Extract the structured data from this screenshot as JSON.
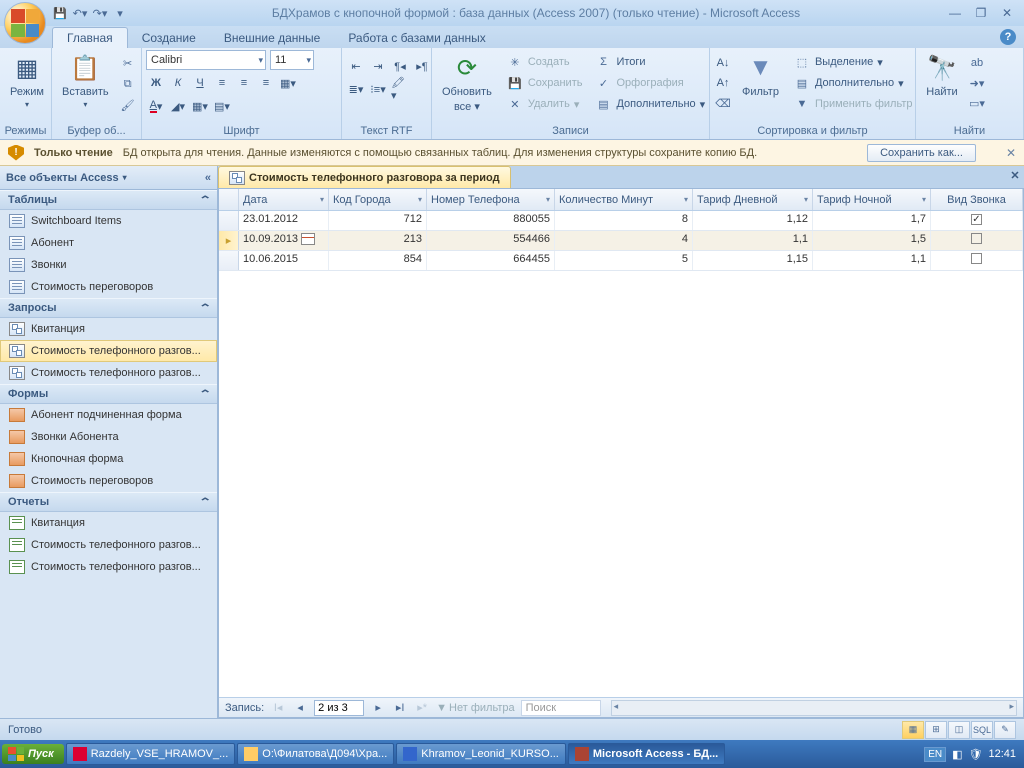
{
  "title": "БДХрамов с кнопочной формой : база данных (Access 2007) (только чтение) - Microsoft Access",
  "tabs": {
    "t1": "Главная",
    "t2": "Создание",
    "t3": "Внешние данные",
    "t4": "Работа с базами данных"
  },
  "ribbon": {
    "g1": {
      "label": "Режимы",
      "btn": "Режим"
    },
    "g2": {
      "label": "Буфер об...",
      "btn": "Вставить"
    },
    "g3": {
      "label": "Шрифт",
      "font": "Calibri",
      "size": "11"
    },
    "g4": {
      "label": "Текст RTF"
    },
    "g5": {
      "label": "Записи",
      "refresh": "Обновить",
      "refresh2": "все",
      "new": "Создать",
      "save": "Сохранить",
      "del": "Удалить",
      "sum": "Итоги",
      "spell": "Орфография",
      "more": "Дополнительно"
    },
    "g6": {
      "label": "Сортировка и фильтр",
      "filter": "Фильтр",
      "sel": "Выделение",
      "adv": "Дополнительно",
      "toggle": "Применить фильтр"
    },
    "g7": {
      "label": "Найти",
      "find": "Найти"
    }
  },
  "msgbar": {
    "title": "Только чтение",
    "text": "БД открыта для чтения. Данные изменяются с помощью связанных таблиц. Для изменения структуры сохраните копию БД.",
    "btn": "Сохранить как..."
  },
  "nav": {
    "header": "Все объекты Access",
    "cat_tables": "Таблицы",
    "tables": [
      "Switchboard Items",
      "Абонент",
      "Звонки",
      "Стоимость переговоров"
    ],
    "cat_queries": "Запросы",
    "queries": [
      "Квитанция",
      "Стоимость телефонного разгов...",
      "Стоимость телефонного разгов..."
    ],
    "cat_forms": "Формы",
    "forms": [
      "Абонент подчиненная форма",
      "Звонки Абонента",
      "Кнопочная форма",
      "Стоимость переговоров"
    ],
    "cat_reports": "Отчеты",
    "reports": [
      "Квитанция",
      "Стоимость телефонного разгов...",
      "Стоимость телефонного разгов..."
    ]
  },
  "doc": {
    "tab": "Стоимость телефонного разговора за период",
    "cols": {
      "c1": "Дата",
      "c2": "Код Города",
      "c3": "Номер Телефона",
      "c4": "Количество Минут",
      "c5": "Тариф Дневной",
      "c6": "Тариф Ночной",
      "c7": "Вид Звонка"
    },
    "rows": [
      {
        "date": "23.01.2012",
        "city": "712",
        "phone": "880055",
        "min": "8",
        "day": "1,12",
        "night": "1,7",
        "kind": true
      },
      {
        "date": "10.09.2013",
        "city": "213",
        "phone": "554466",
        "min": "4",
        "day": "1,1",
        "night": "1,5",
        "kind": false
      },
      {
        "date": "10.06.2015",
        "city": "854",
        "phone": "664455",
        "min": "5",
        "day": "1,15",
        "night": "1,1",
        "kind": false
      }
    ]
  },
  "recnav": {
    "label": "Запись:",
    "pos": "2 из 3",
    "filter": "Нет фильтра",
    "search": "Поиск"
  },
  "status": "Готово",
  "taskbar": {
    "start": "Пуск",
    "btns": [
      "Razdely_VSE_HRAMOV_...",
      "O:\\Филатова\\Д094\\Хра...",
      "Khramov_Leonid_KURSO...",
      "Microsoft Access - БД..."
    ],
    "lang": "EN",
    "time": "12:41"
  }
}
